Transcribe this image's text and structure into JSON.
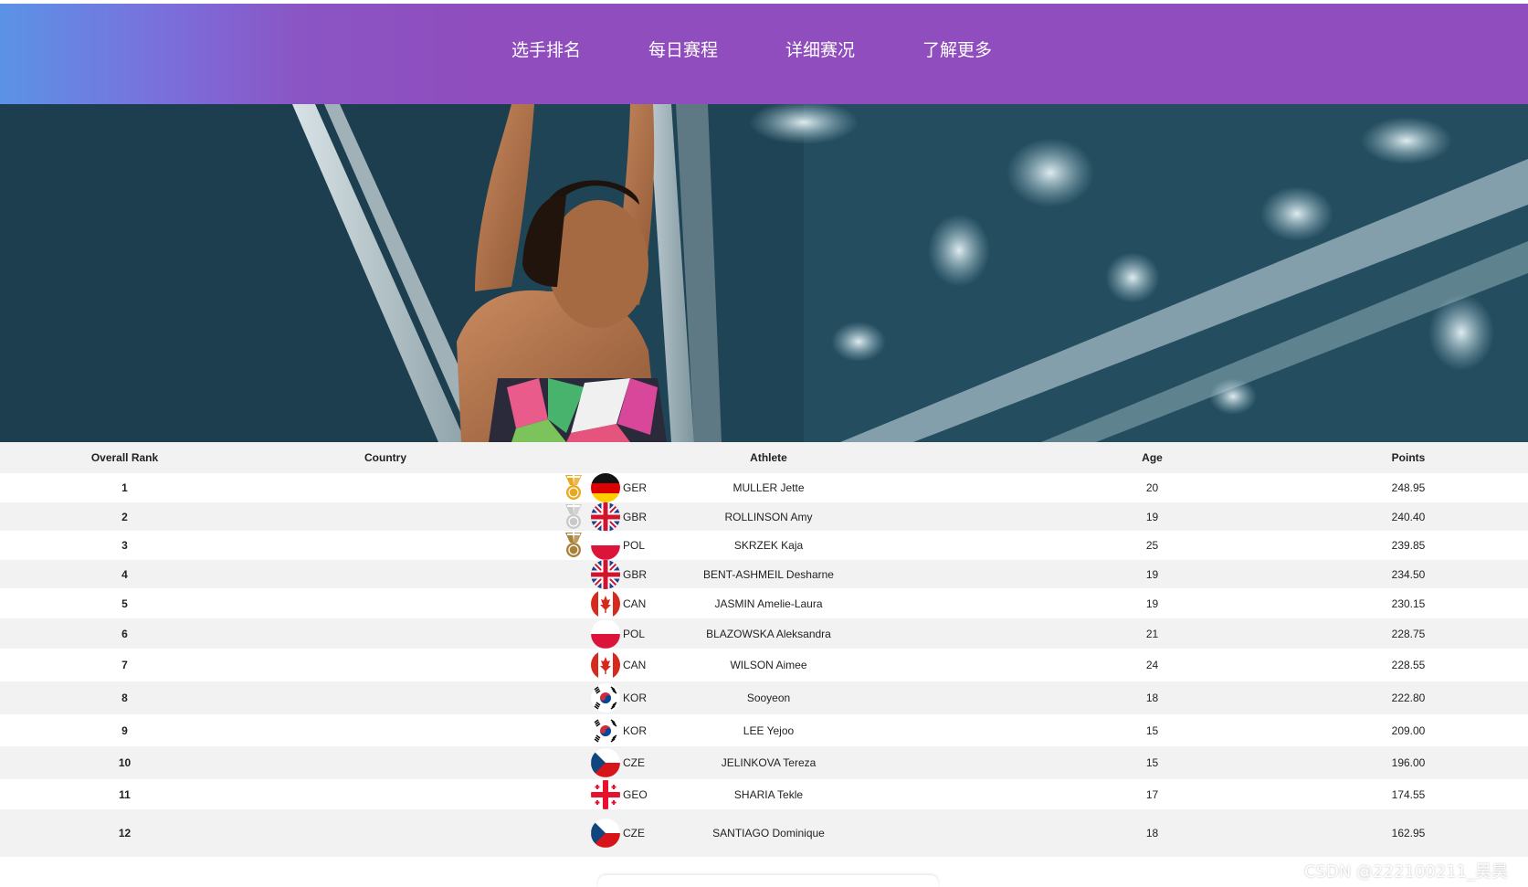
{
  "nav": {
    "items": [
      "选手排名",
      "每日赛程",
      "详细赛况",
      "了解更多"
    ]
  },
  "table": {
    "headers": [
      "Overall Rank",
      "Country",
      "Athlete",
      "Age",
      "Points"
    ],
    "rows": [
      {
        "rank": "1",
        "medal": "gold",
        "flag": "GER",
        "country": "GER",
        "athlete": "MULLER Jette",
        "age": "20",
        "points": "248.95"
      },
      {
        "rank": "2",
        "medal": "silver",
        "flag": "GBR",
        "country": "GBR",
        "athlete": "ROLLINSON Amy",
        "age": "19",
        "points": "240.40"
      },
      {
        "rank": "3",
        "medal": "bronze",
        "flag": "POL",
        "country": "POL",
        "athlete": "SKRZEK Kaja",
        "age": "25",
        "points": "239.85"
      },
      {
        "rank": "4",
        "medal": "",
        "flag": "GBR",
        "country": "GBR",
        "athlete": "BENT-ASHMEIL Desharne",
        "age": "19",
        "points": "234.50"
      },
      {
        "rank": "5",
        "medal": "",
        "flag": "CAN",
        "country": "CAN",
        "athlete": "JASMIN Amelie-Laura",
        "age": "19",
        "points": "230.15"
      },
      {
        "rank": "6",
        "medal": "",
        "flag": "POL",
        "country": "POL",
        "athlete": "BLAZOWSKA Aleksandra",
        "age": "21",
        "points": "228.75"
      },
      {
        "rank": "7",
        "medal": "",
        "flag": "CAN",
        "country": "CAN",
        "athlete": "WILSON Aimee",
        "age": "24",
        "points": "228.55"
      },
      {
        "rank": "8",
        "medal": "",
        "flag": "KOR",
        "country": "KOR",
        "athlete": "Sooyeon",
        "age": "18",
        "points": "222.80"
      },
      {
        "rank": "9",
        "medal": "",
        "flag": "KOR",
        "country": "KOR",
        "athlete": "LEE Yejoo",
        "age": "15",
        "points": "209.00"
      },
      {
        "rank": "10",
        "medal": "",
        "flag": "CZE",
        "country": "CZE",
        "athlete": "JELINKOVA Tereza",
        "age": "15",
        "points": "196.00"
      },
      {
        "rank": "11",
        "medal": "",
        "flag": "GEO",
        "country": "GEO",
        "athlete": "SHARIA Tekle",
        "age": "17",
        "points": "174.55"
      },
      {
        "rank": "12",
        "medal": "",
        "flag": "CZE",
        "country": "CZE",
        "athlete": "SANTIAGO Dominique",
        "age": "18",
        "points": "162.95"
      }
    ]
  },
  "watermark": "CSDN @222100211_吴昊",
  "colors": {
    "nav_gradient_start": "#5b93e6",
    "nav_gradient_end": "#8f4dbd",
    "gold": "#e8a820",
    "silver": "#c9c9c9",
    "bronze": "#a8823c"
  }
}
